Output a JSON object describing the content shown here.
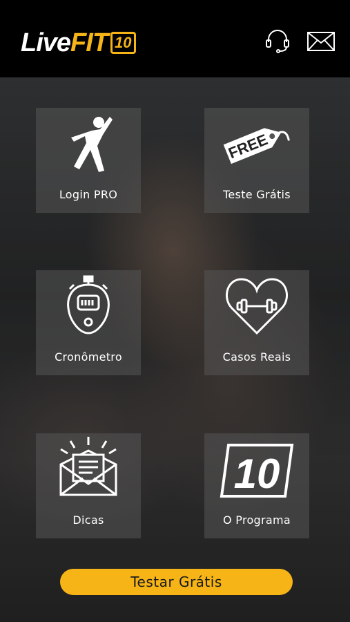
{
  "header": {
    "logo": {
      "part1": "LiveFIT",
      "live": "Live",
      "fit": "FIT",
      "ten": "10"
    },
    "support_icon": "headset-icon",
    "mail_icon": "envelope-icon"
  },
  "tiles": [
    {
      "label": "Login PRO",
      "icon": "stretching-person-icon"
    },
    {
      "label": "Teste Grátis",
      "icon": "free-tag-icon",
      "tag_text": "FREE"
    },
    {
      "label": "Cronômetro",
      "icon": "stopwatch-icon"
    },
    {
      "label": "Casos Reais",
      "icon": "heart-dumbbell-icon"
    },
    {
      "label": "Dicas",
      "icon": "envelope-letter-icon"
    },
    {
      "label": "O Programa",
      "icon": "ten-logo-icon",
      "badge_text": "10"
    }
  ],
  "cta": {
    "label": "Testar Grátis"
  },
  "colors": {
    "accent": "#f6b417",
    "header_bg": "#000000",
    "tile_bg": "rgba(85,85,85,0.55)"
  }
}
